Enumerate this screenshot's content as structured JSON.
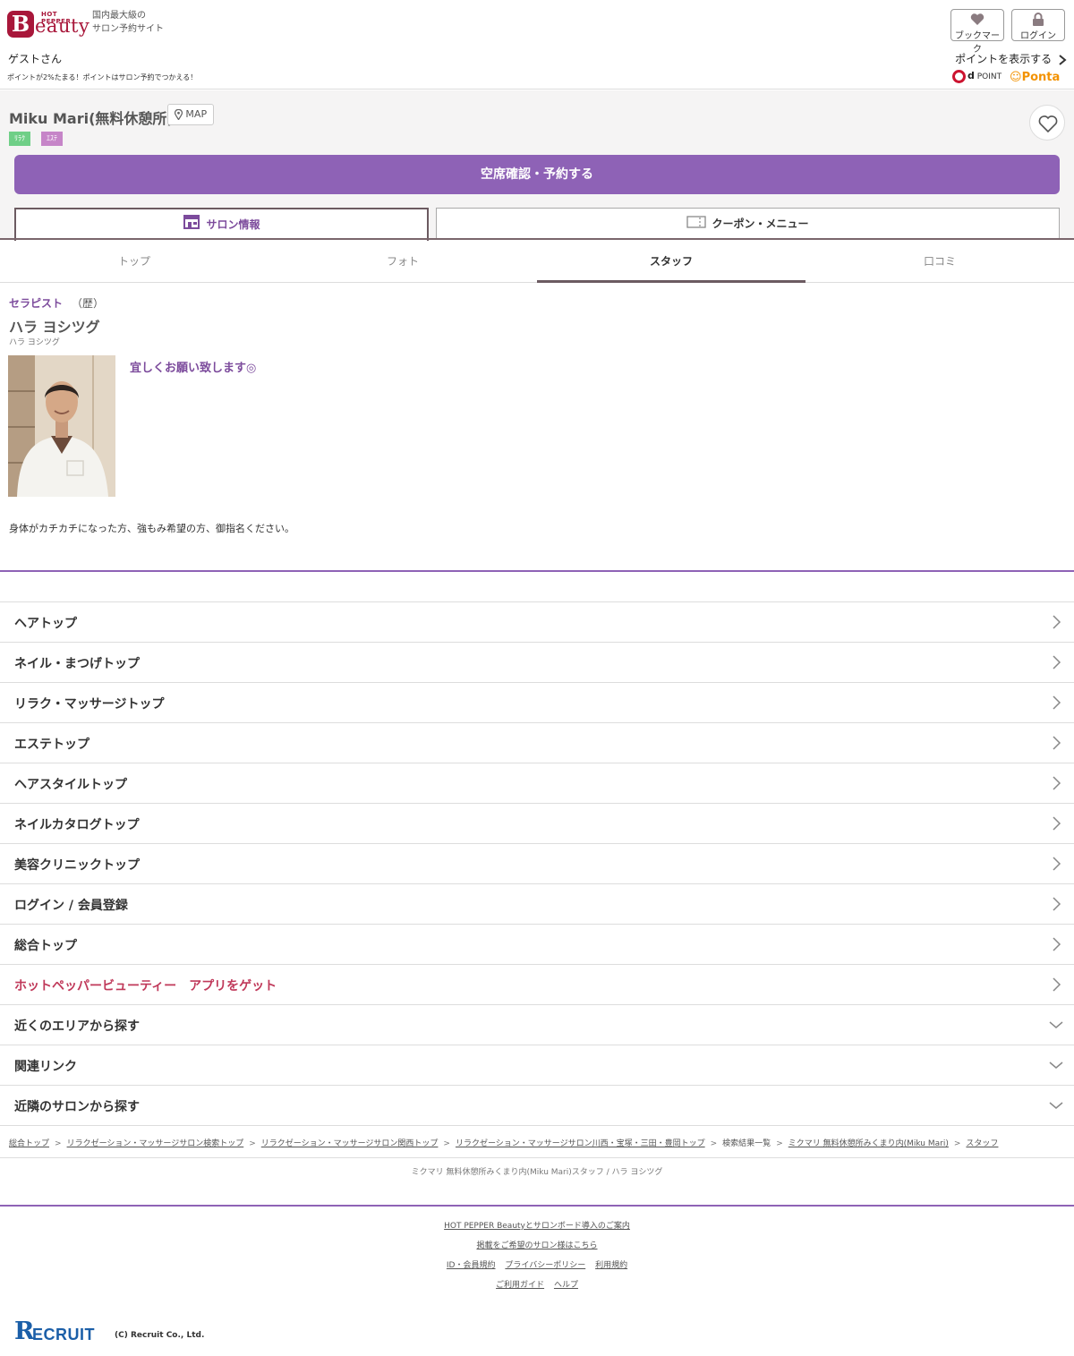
{
  "header": {
    "logo_hotpepper": "HOT PEPPER",
    "logo_b": "B",
    "logo_rest": "eauty",
    "tagline_line1": "国内最大級の",
    "tagline_line2": "サロン予約サイト",
    "bookmark_label": "ブックマーク",
    "login_label": "ログイン",
    "guest": "ゲストさん",
    "points_note": "ポイントが2%たまる！ポイントはサロン予約でつかえる！",
    "show_points": "ポイントを表示する",
    "dpoint_label": "POINT",
    "ponta_label": "Ponta"
  },
  "salon": {
    "name": "Miku Mari(無料休憩所)",
    "map_label": "MAP",
    "tags": [
      "ﾘﾗｸ",
      "ｴｽﾃ"
    ],
    "reserve_label": "空席確認・予約する",
    "tabs": [
      {
        "label": "サロン情報",
        "active": true
      },
      {
        "label": "クーポン・メニュー",
        "active": false
      }
    ]
  },
  "subtabs": [
    "トップ",
    "フォト",
    "スタッフ",
    "口コミ"
  ],
  "staff": {
    "role": "セラピスト",
    "role_sub": "（歴）",
    "name": "ハラ ヨシツグ",
    "kana": "ハラ ヨシツグ",
    "catch": "宜しくお願い致します◎",
    "description": "身体がカチカチになった方、強もみ希望の方、御指名ください。"
  },
  "nav": [
    {
      "label": "ヘアトップ",
      "type": "link"
    },
    {
      "label": "ネイル・まつげトップ",
      "type": "link"
    },
    {
      "label": "リラク・マッサージトップ",
      "type": "link"
    },
    {
      "label": "エステトップ",
      "type": "link"
    },
    {
      "label": "ヘアスタイルトップ",
      "type": "link"
    },
    {
      "label": "ネイルカタログトップ",
      "type": "link"
    },
    {
      "label": "美容クリニックトップ",
      "type": "link"
    },
    {
      "label": "ログイン / 会員登録",
      "type": "link"
    },
    {
      "label": "総合トップ",
      "type": "link"
    },
    {
      "label": "ホットペッパービューティー　アプリをゲット",
      "type": "app"
    },
    {
      "label": "近くのエリアから探す",
      "type": "expand"
    },
    {
      "label": "関連リンク",
      "type": "expand"
    },
    {
      "label": "近隣のサロンから探す",
      "type": "expand"
    }
  ],
  "breadcrumb": [
    {
      "label": "総合トップ",
      "link": true
    },
    {
      "label": "リラクゼーション・マッサージサロン検索トップ",
      "link": true
    },
    {
      "label": "リラクゼーション・マッサージサロン関西トップ",
      "link": true
    },
    {
      "label": "リラクゼーション・マッサージサロン川西・宝塚・三田・豊岡トップ",
      "link": true
    },
    {
      "label": "検索結果一覧",
      "link": false
    },
    {
      "label": "ミクマリ 無料休憩所みくまり内(Miku Mari)",
      "link": true
    },
    {
      "label": "スタッフ",
      "link": true
    }
  ],
  "breadcrumb_sep": ">",
  "page_caption": "ミクマリ 無料休憩所みくまり内(Miku Mari)スタッフ / ハラ ヨシツグ",
  "footer": {
    "links_row1": [
      "HOT PEPPER Beautyとサロンボード導入のご案内"
    ],
    "links_row2": [
      "掲載をご希望のサロン様はこちら"
    ],
    "links_row3": [
      "ID・会員規約",
      "プライバシーポリシー",
      "利用規約"
    ],
    "links_row4": [
      "ご利用ガイド",
      "ヘルプ"
    ],
    "recruit_r": "R",
    "recruit_rest": "ECRUIT",
    "copyright": "(C) Recruit Co., Ltd."
  },
  "colors": {
    "brand": "#a8173a",
    "accent": "#8e62b6",
    "salon_text": "#7c4b9c",
    "app_link": "#c0395a",
    "recruit": "#1b5fa8"
  }
}
